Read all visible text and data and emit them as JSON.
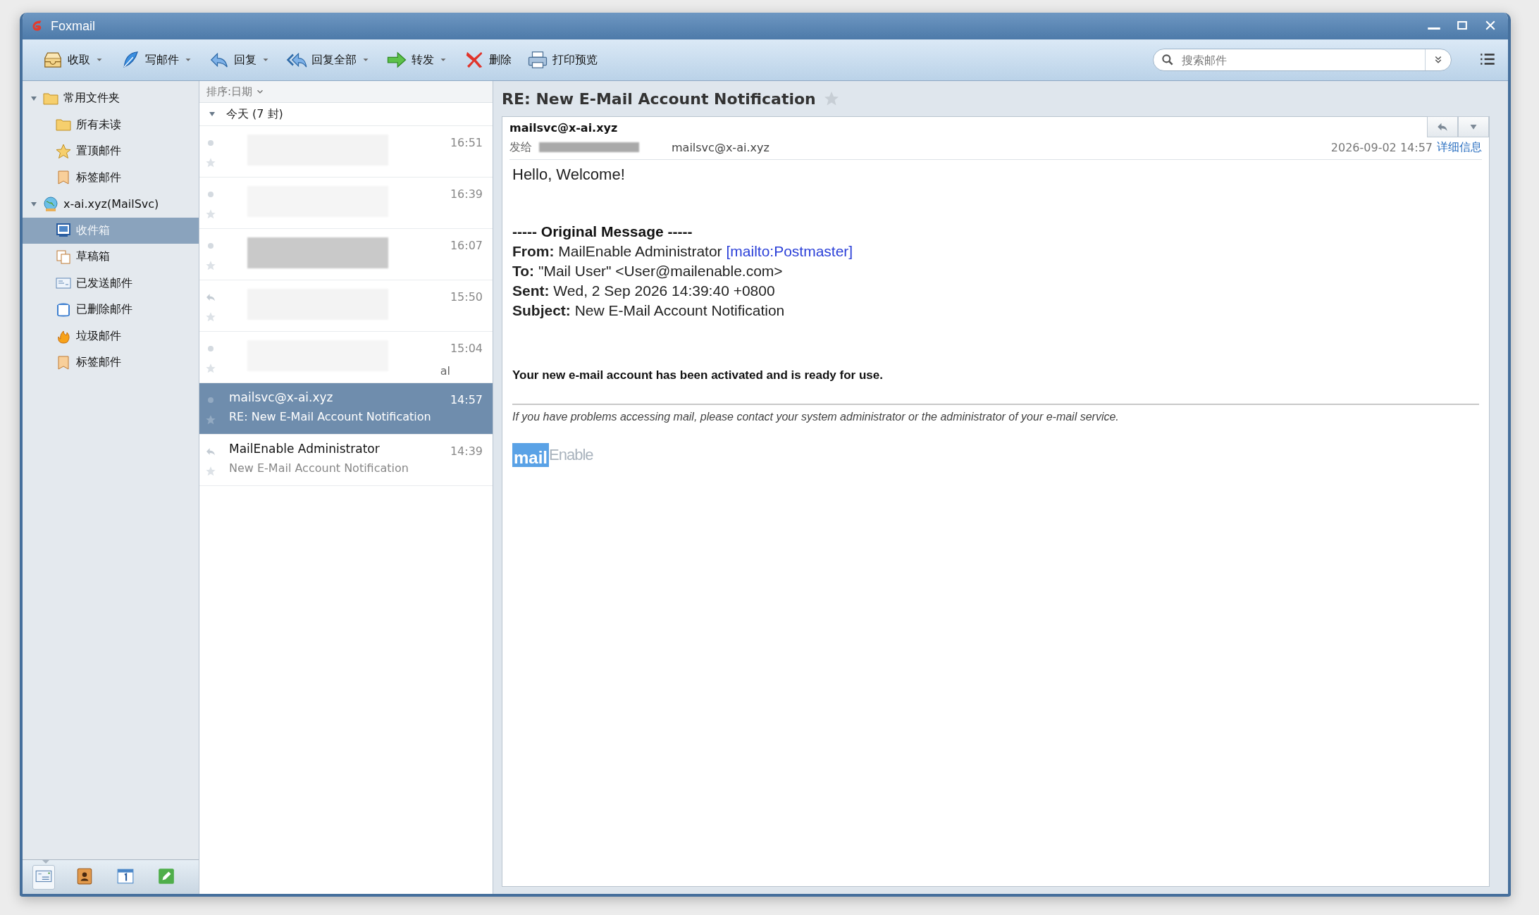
{
  "window": {
    "title": "Foxmail"
  },
  "toolbar": [
    {
      "kind": "tray",
      "label": "收取",
      "dropdown": true
    },
    {
      "kind": "feather",
      "label": "写邮件",
      "dropdown": true
    },
    {
      "kind": "reply",
      "label": "回复",
      "dropdown": true
    },
    {
      "kind": "reply-all",
      "label": "回复全部",
      "dropdown": true
    },
    {
      "kind": "forward",
      "label": "转发",
      "dropdown": true
    },
    {
      "kind": "delete",
      "label": "删除",
      "dropdown": false
    },
    {
      "kind": "print",
      "label": "打印预览",
      "dropdown": false
    }
  ],
  "search": {
    "placeholder": "搜索邮件"
  },
  "sidebar": {
    "items": [
      {
        "kind": "folder",
        "label": "常用文件夹",
        "expanded": true,
        "selected": false,
        "children": [
          {
            "kind": "folder",
            "label": "所有未读",
            "selected": false
          },
          {
            "kind": "star",
            "label": "置顶邮件",
            "selected": false
          },
          {
            "kind": "tag",
            "label": "标签邮件",
            "selected": false
          }
        ]
      },
      {
        "kind": "account",
        "label": "x-ai.xyz(MailSvc)",
        "expanded": true,
        "selected": false,
        "children": [
          {
            "kind": "inbox",
            "label": "收件箱",
            "selected": true
          },
          {
            "kind": "drafts",
            "label": "草稿箱",
            "selected": false
          },
          {
            "kind": "sent",
            "label": "已发送邮件",
            "selected": false
          },
          {
            "kind": "trash",
            "label": "已删除邮件",
            "selected": false
          },
          {
            "kind": "junk",
            "label": "垃圾邮件",
            "selected": false
          },
          {
            "kind": "tag",
            "label": "标签邮件",
            "selected": false
          }
        ]
      }
    ]
  },
  "bottom_bar": [
    {
      "kind": "mail",
      "selected": true
    },
    {
      "kind": "contacts",
      "selected": false
    },
    {
      "kind": "calendar",
      "selected": false
    },
    {
      "kind": "notes",
      "selected": false
    }
  ],
  "message_list": {
    "sort_label": "排序:日期",
    "group": {
      "label": "今天 (7 封)",
      "expanded": true
    },
    "messages": [
      {
        "time": "16:51",
        "redacted": true,
        "replied": false,
        "starred": false,
        "selected": false
      },
      {
        "time": "16:39",
        "redacted": true,
        "replied": false,
        "starred": false,
        "selected": false
      },
      {
        "time": "16:07",
        "redacted": true,
        "replied": false,
        "starred": false,
        "selected": false
      },
      {
        "time": "15:50",
        "redacted": true,
        "replied": true,
        "starred": false,
        "selected": false
      },
      {
        "time": "15:04",
        "redacted": true,
        "subject": "al",
        "replied": false,
        "starred": false,
        "selected": false
      },
      {
        "time": "14:57",
        "sender": "mailsvc@x-ai.xyz",
        "subject": "RE: New E-Mail Account Notification",
        "redacted": false,
        "replied": false,
        "starred": false,
        "selected": true
      },
      {
        "time": "14:39",
        "sender": "MailEnable Administrator",
        "subject": "New E-Mail Account Notification",
        "redacted": false,
        "replied": true,
        "starred": false,
        "selected": false
      }
    ]
  },
  "reading_pane": {
    "subject": "RE: New E-Mail Account Notification",
    "starred": false,
    "from": "mailsvc@x-ai.xyz",
    "to_label": "发给",
    "recipient": "mailsvc@x-ai.xyz",
    "date": "2026-09-02 14:57",
    "details_link": "详细信息",
    "body": [
      {
        "kind": "text",
        "text": "Hello, Welcome!"
      },
      {
        "kind": "heading",
        "text": "----- Original Message -----"
      },
      {
        "kind": "field",
        "label": "From:",
        "value": "MailEnable Administrator",
        "link": "[mailto:Postmaster]"
      },
      {
        "kind": "field",
        "label": "To:",
        "value": "\"Mail User\" <User@mailenable.com>"
      },
      {
        "kind": "field",
        "label": "Sent:",
        "value": "Wed, 2 Sep 2026 14:39:40 +0800"
      },
      {
        "kind": "field",
        "label": "Subject:",
        "value": "New E-Mail Account Notification"
      },
      {
        "kind": "notice",
        "text": "Your new e-mail account has been activated and is ready for use."
      },
      {
        "kind": "rule"
      },
      {
        "kind": "footer",
        "text": "If you have problems accessing mail, please contact your system administrator or the administrator of your e-mail service."
      },
      {
        "kind": "logo",
        "mark": "mail",
        "word": "Enable"
      }
    ]
  }
}
